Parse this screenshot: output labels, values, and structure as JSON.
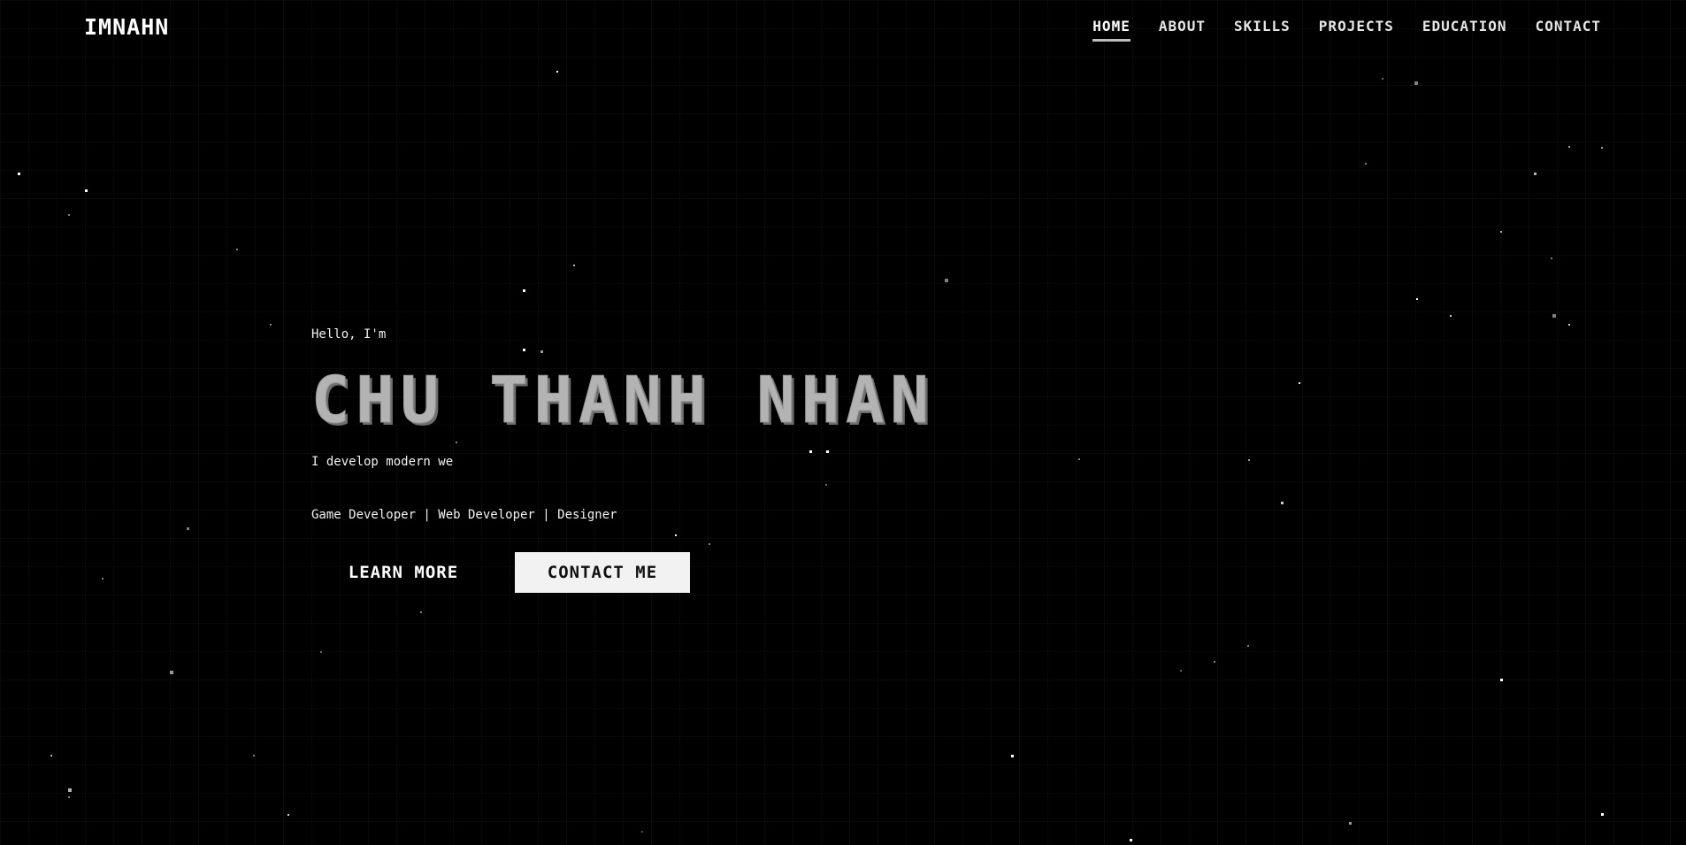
{
  "header": {
    "logo": "IMNAHN",
    "nav": [
      {
        "label": "HOME",
        "active": true
      },
      {
        "label": "ABOUT",
        "active": false
      },
      {
        "label": "SKILLS",
        "active": false
      },
      {
        "label": "PROJECTS",
        "active": false
      },
      {
        "label": "EDUCATION",
        "active": false
      },
      {
        "label": "CONTACT",
        "active": false
      }
    ]
  },
  "hero": {
    "greeting": "Hello, I'm",
    "name": "CHU THANH NHAN",
    "tagline": "I develop modern we",
    "roles": "Game Developer | Web Developer | Designer",
    "learn_more_label": "LEARN MORE",
    "contact_me_label": "CONTACT ME"
  },
  "colors": {
    "background": "#000000",
    "name_fill": "#b3b3b3",
    "solid_button_bg": "#f2f2f2",
    "text": "#ffffff"
  }
}
